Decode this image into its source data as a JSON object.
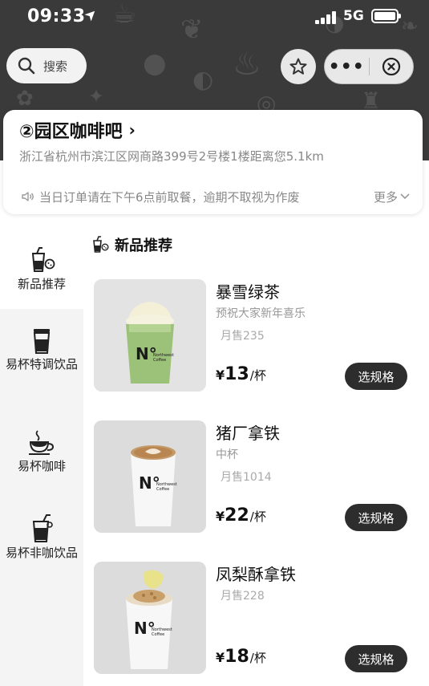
{
  "status_bar": {
    "time": "09:33",
    "network": "5G"
  },
  "search": {
    "label": "搜索"
  },
  "store": {
    "name": "②园区咖啡吧",
    "address": "浙江省杭州市滨江区网商路399号2号楼1楼距离您5.1km",
    "notice": "当日订单请在下午6点前取餐，逾期不取视为作废",
    "more_label": "更多"
  },
  "sidebar": {
    "categories": [
      {
        "label": "新品推荐",
        "icon": "new-drinks-icon",
        "active": true
      },
      {
        "label": "易杯特调饮品",
        "icon": "special-drink-cup-icon",
        "active": false
      },
      {
        "label": "易杯咖啡",
        "icon": "coffee-cup-icon",
        "active": false
      },
      {
        "label": "易杯非咖饮品",
        "icon": "non-coffee-drink-icon",
        "active": false
      }
    ]
  },
  "section": {
    "title": "新品推荐"
  },
  "products": [
    {
      "name": "暴雪绿茶",
      "subtitle": "预祝大家新年喜乐",
      "sales": "月售235",
      "currency": "¥",
      "price": "13",
      "unit": "/杯",
      "button": "选规格"
    },
    {
      "name": "猪厂拿铁",
      "subtitle": "中杯",
      "sales": "月售1014",
      "currency": "¥",
      "price": "22",
      "unit": "/杯",
      "button": "选规格"
    },
    {
      "name": "凤梨酥拿铁",
      "subtitle": "",
      "sales": "月售228",
      "currency": "¥",
      "price": "18",
      "unit": "/杯",
      "button": "选规格"
    }
  ],
  "colors": {
    "header_bg": "#3a3a3a",
    "button_bg": "#2d2d2d",
    "sidebar_bg": "#f4f4f4"
  }
}
